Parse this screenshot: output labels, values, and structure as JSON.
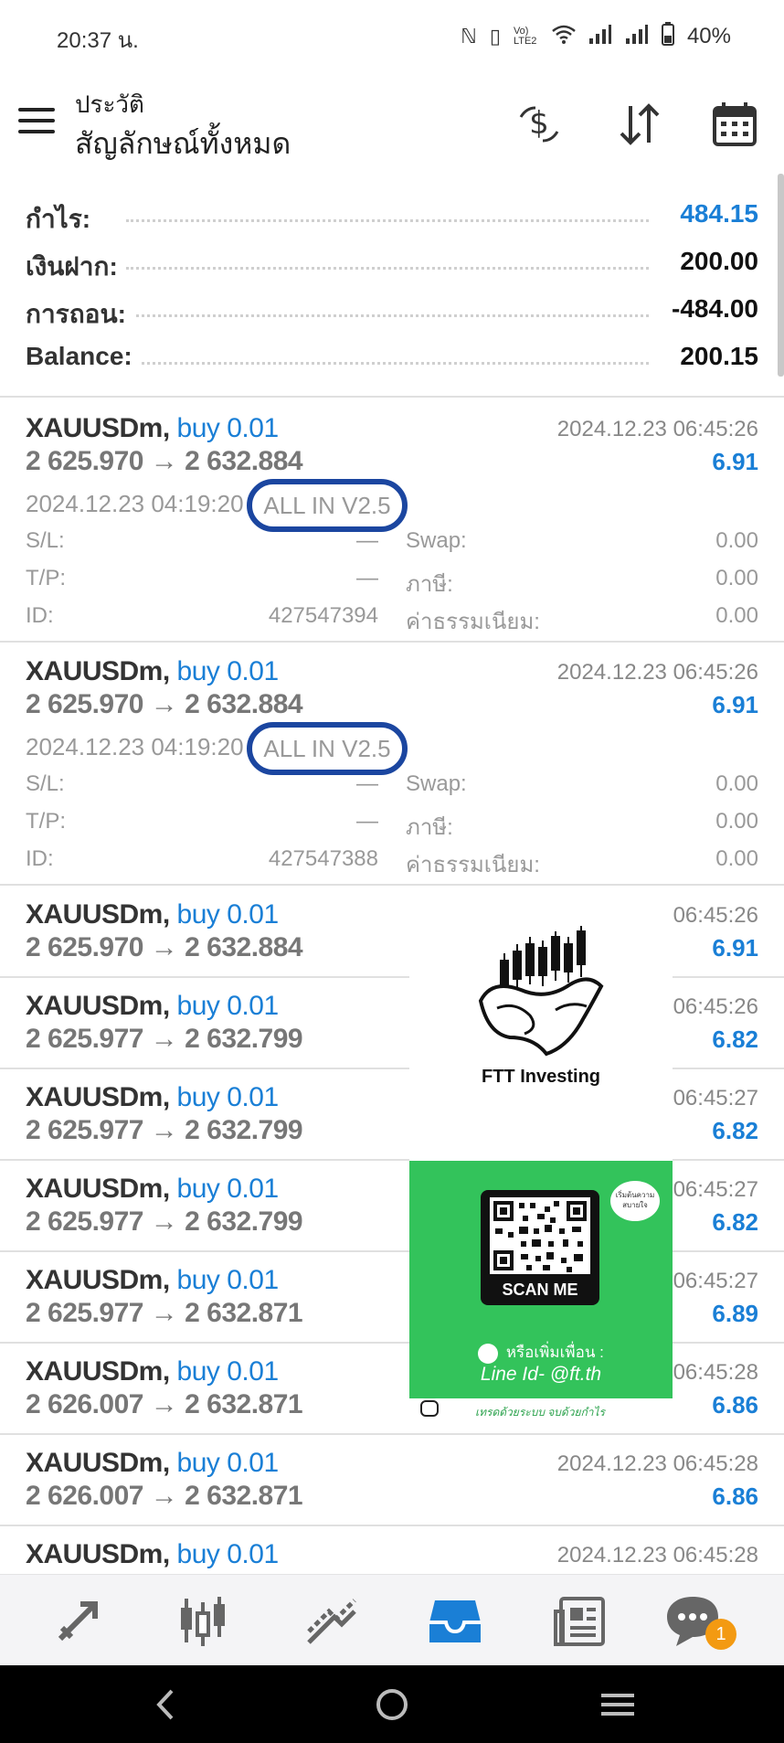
{
  "status_bar": {
    "time": "20:37 น.",
    "signal_text": "Vo) LTE2",
    "battery": "40%"
  },
  "header": {
    "subtitle": "ประวัติ",
    "title": "สัญลักษณ์ทั้งหมด"
  },
  "icons": {
    "menu": "hamburger-menu-icon",
    "deposit": "dollar-exchange-icon",
    "sort": "sort-arrows-icon",
    "calendar": "calendar-icon"
  },
  "summary": {
    "profit_label": "กำไร:",
    "profit_value": "484.15",
    "deposit_label": "เงินฝาก:",
    "deposit_value": "200.00",
    "withdraw_label": "การถอน:",
    "withdraw_value": "-484.00",
    "balance_label": "Balance:",
    "balance_value": "200.15"
  },
  "detail_labels": {
    "sl": "S/L:",
    "tp": "T/P:",
    "id": "ID:",
    "swap": "Swap:",
    "tax": "ภาษี:",
    "commission": "ค่าธรรมเนียม:"
  },
  "trades": [
    {
      "symbol": "XAUUSDm,",
      "side": "buy 0.01",
      "price": "2 625.970 → 2 632.884",
      "close_time": "2024.12.23 06:45:26",
      "profit": "6.91",
      "open_time": "2024.12.23 04:19:20",
      "comment": "ALL IN V2.5",
      "sl": "—",
      "tp": "—",
      "id": "427547394",
      "swap": "0.00",
      "tax": "0.00",
      "commission": "0.00"
    },
    {
      "symbol": "XAUUSDm,",
      "side": "buy 0.01",
      "price": "2 625.970 → 2 632.884",
      "close_time": "2024.12.23 06:45:26",
      "profit": "6.91",
      "open_time": "2024.12.23 04:19:20",
      "comment": "ALL IN V2.5",
      "sl": "—",
      "tp": "—",
      "id": "427547388",
      "swap": "0.00",
      "tax": "0.00",
      "commission": "0.00"
    },
    {
      "symbol": "XAUUSDm,",
      "side": "buy 0.01",
      "price": "2 625.970 → 2 632.884",
      "close_time": "06:45:26",
      "profit": "6.91"
    },
    {
      "symbol": "XAUUSDm,",
      "side": "buy 0.01",
      "price": "2 625.977 → 2 632.799",
      "close_time": "06:45:26",
      "profit": "6.82"
    },
    {
      "symbol": "XAUUSDm,",
      "side": "buy 0.01",
      "price": "2 625.977 → 2 632.799",
      "close_time": "06:45:27",
      "profit": "6.82"
    },
    {
      "symbol": "XAUUSDm,",
      "side": "buy 0.01",
      "price": "2 625.977 → 2 632.799",
      "close_time": "06:45:27",
      "profit": "6.82"
    },
    {
      "symbol": "XAUUSDm,",
      "side": "buy 0.01",
      "price": "2 625.977 → 2 632.871",
      "close_time": "06:45:27",
      "profit": "6.89"
    },
    {
      "symbol": "XAUUSDm,",
      "side": "buy 0.01",
      "price": "2 626.007 → 2 632.871",
      "close_time": "06:45:28",
      "profit": "6.86"
    },
    {
      "symbol": "XAUUSDm,",
      "side": "buy 0.01",
      "price": "2 626.007 → 2 632.871",
      "close_time": "2024.12.23 06:45:28",
      "profit": "6.86"
    },
    {
      "symbol": "XAUUSDm,",
      "side": "buy 0.01",
      "close_time": "2024.12.23 06:45:28"
    }
  ],
  "ad": {
    "brand": "FTT Investing",
    "scan_label": "SCAN ME",
    "bubble_text": "เริ่มต้นความสบายใจ",
    "add_friend": "หรือเพิ่มเพื่อน :",
    "line_id": "Line Id- @ft.th",
    "slogan": "เทรดด้วยระบบ จบด้วยกำไร",
    "green_color": "#33c35b"
  },
  "bottom_nav": {
    "items": [
      "trade-icon",
      "quotes-icon",
      "chart-icon",
      "history-icon",
      "news-icon",
      "chat-icon"
    ],
    "active": "history-icon",
    "chat_badge": "1",
    "active_color": "#1a7fd6"
  },
  "system_nav": [
    "back-icon",
    "home-icon",
    "recents-icon"
  ]
}
